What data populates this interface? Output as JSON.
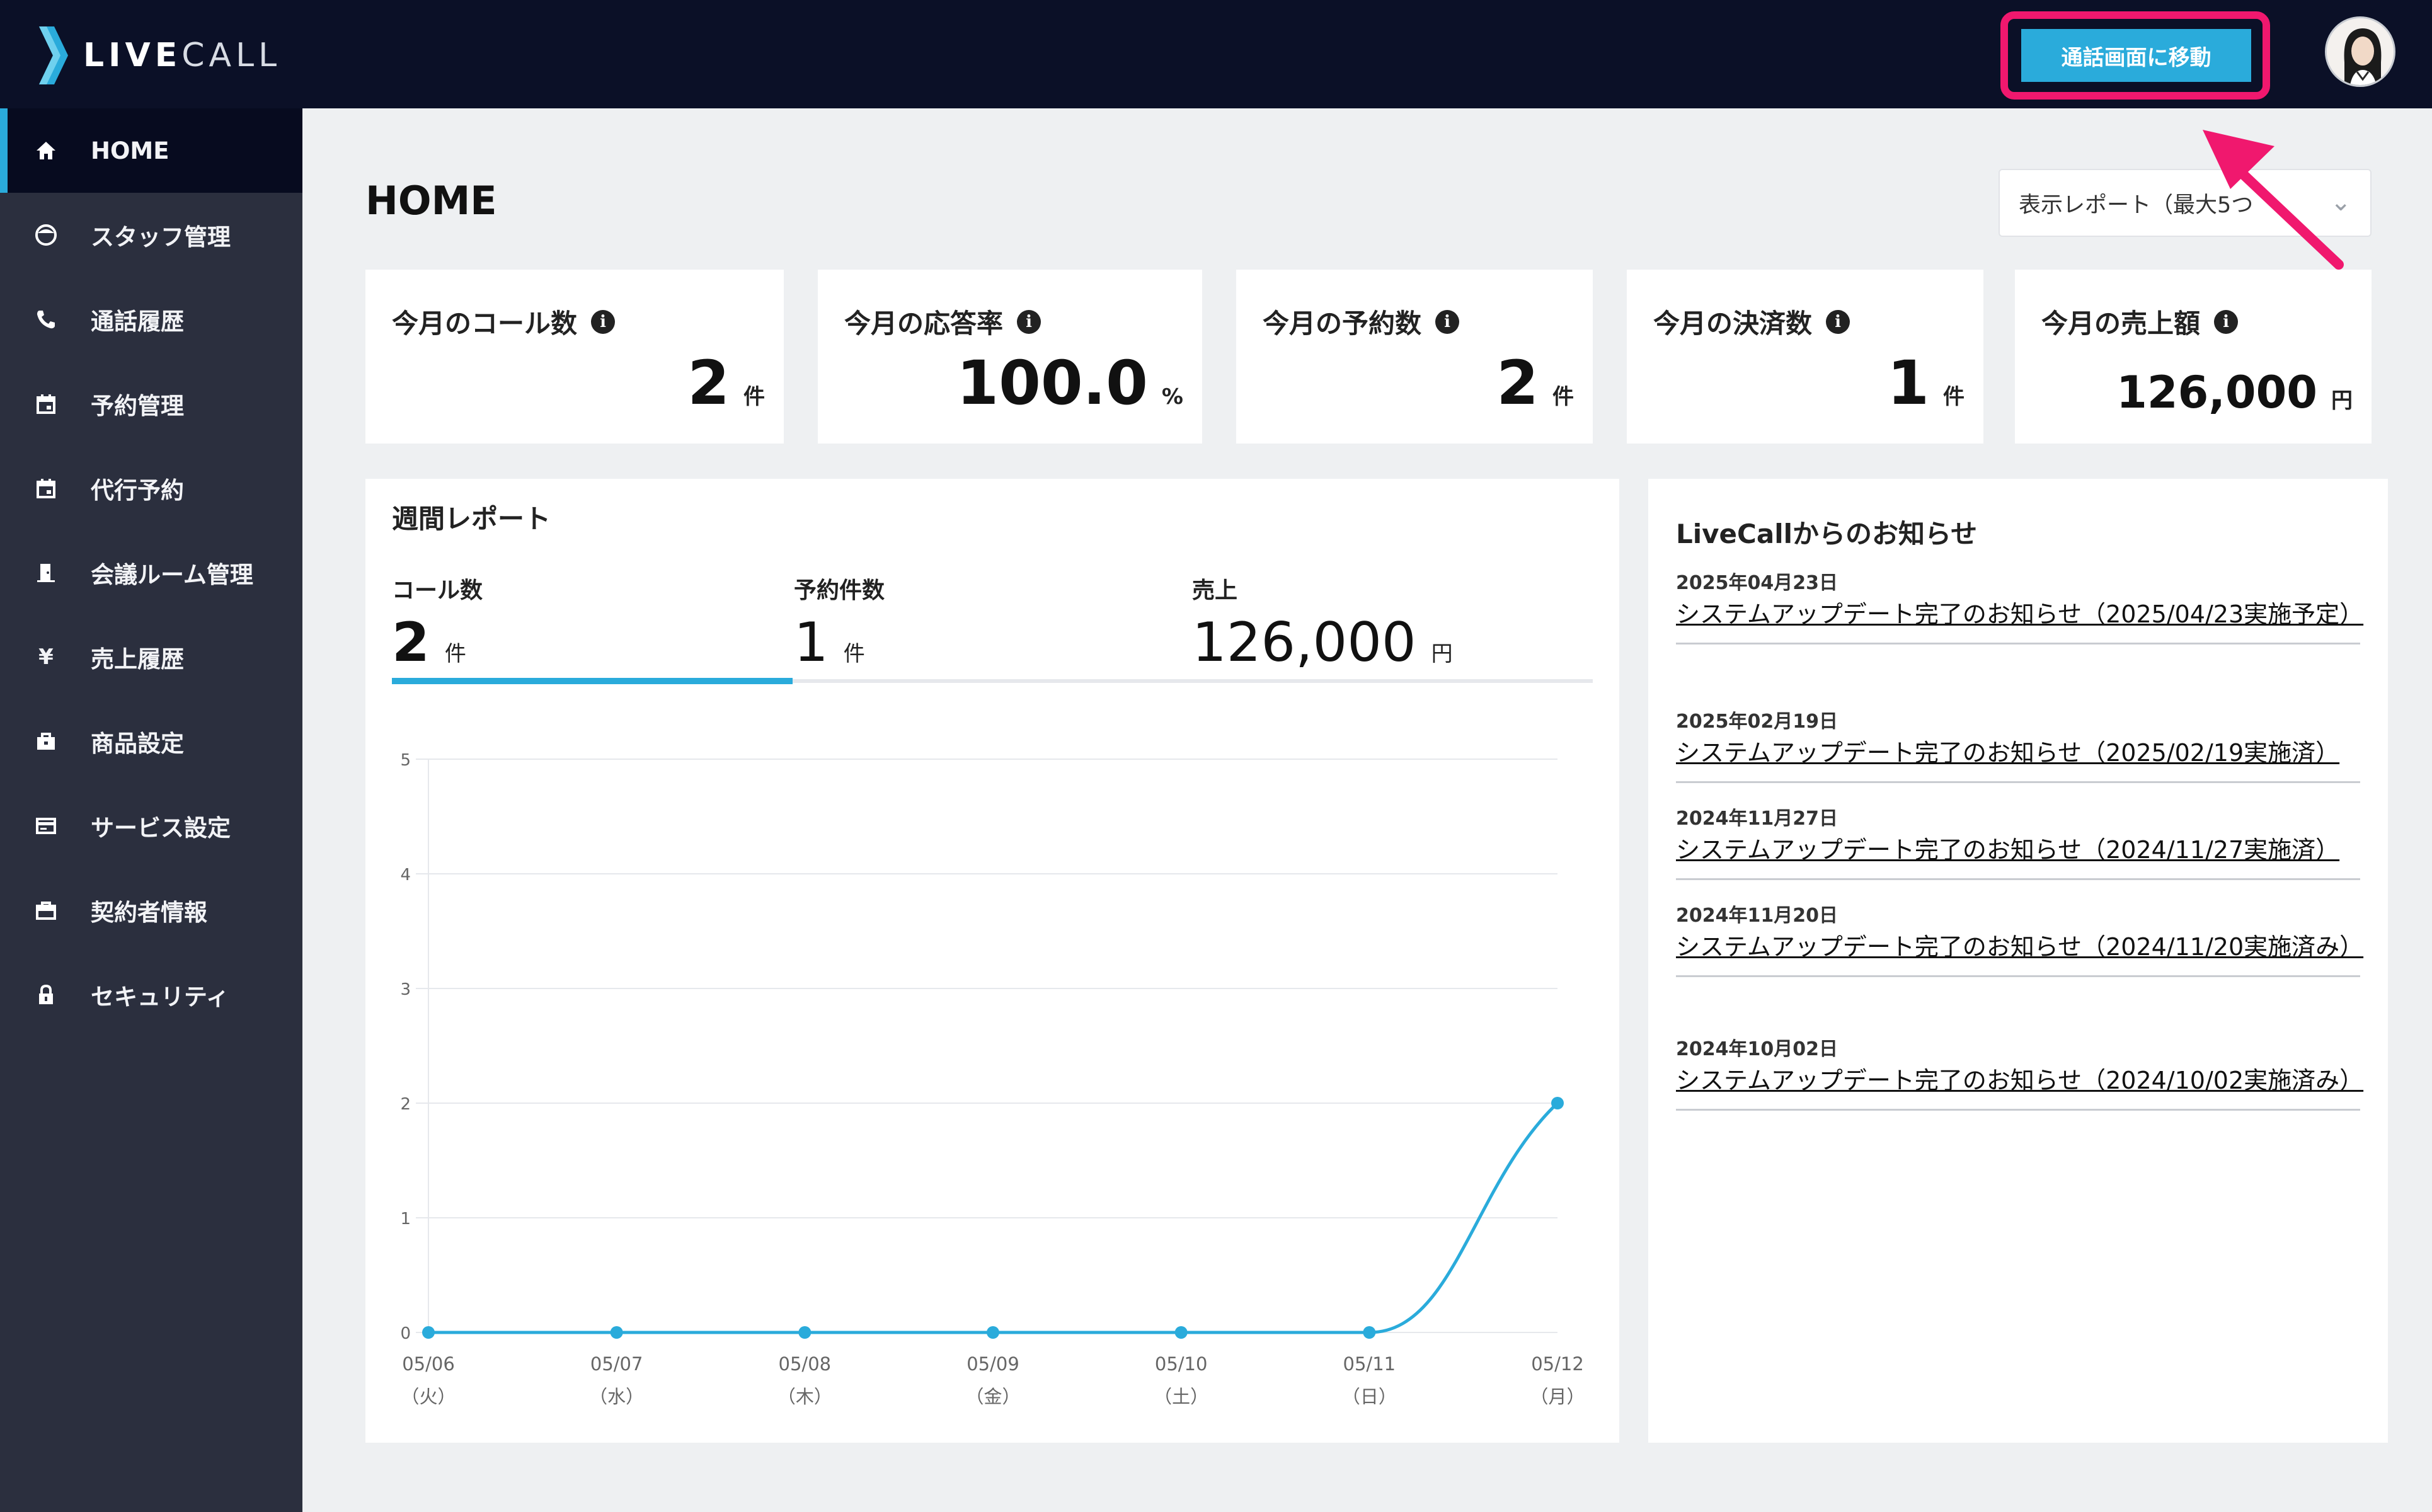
{
  "header": {
    "logo_text_a": "LIVE",
    "logo_text_b": "CALL",
    "call_button_label": "通話画面に移動",
    "brand_color": "#2aabdb",
    "highlight_color": "#f0186e"
  },
  "sidebar": {
    "items": [
      {
        "label": "HOME",
        "icon": "home-icon",
        "glyph": "⌂"
      },
      {
        "label": "スタッフ管理",
        "icon": "staff-icon",
        "glyph": "☺"
      },
      {
        "label": "通話履歴",
        "icon": "phone-icon",
        "glyph": "☏"
      },
      {
        "label": "予約管理",
        "icon": "calendar-icon",
        "glyph": "▦"
      },
      {
        "label": "代行予約",
        "icon": "calendar-plus-icon",
        "glyph": "▦"
      },
      {
        "label": "会議ルーム管理",
        "icon": "door-icon",
        "glyph": "▮"
      },
      {
        "label": "売上履歴",
        "icon": "yen-icon",
        "glyph": "¥"
      },
      {
        "label": "商品設定",
        "icon": "bag-icon",
        "glyph": "▣"
      },
      {
        "label": "サービス設定",
        "icon": "card-icon",
        "glyph": "▤"
      },
      {
        "label": "契約者情報",
        "icon": "briefcase-icon",
        "glyph": "▭"
      },
      {
        "label": "セキュリティ",
        "icon": "lock-icon",
        "glyph": "▲"
      }
    ]
  },
  "main": {
    "title": "HOME",
    "report_select": "表示レポート（最大5つ",
    "stats": [
      {
        "label": "今月のコール数",
        "value": "2",
        "unit": "件"
      },
      {
        "label": "今月の応答率",
        "value": "100.0",
        "unit": "%"
      },
      {
        "label": "今月の予約数",
        "value": "2",
        "unit": "件"
      },
      {
        "label": "今月の決済数",
        "value": "1",
        "unit": "件"
      },
      {
        "label": "今月の売上額",
        "value": "126,000",
        "unit": "円"
      }
    ],
    "weekly": {
      "title": "週間レポート",
      "metrics": [
        {
          "label": "コール数",
          "value": "2",
          "unit": "件"
        },
        {
          "label": "予約件数",
          "value": "1",
          "unit": "件"
        },
        {
          "label": "売上",
          "value": "126,000",
          "unit": "円"
        }
      ]
    }
  },
  "chart_data": {
    "type": "line",
    "title": "",
    "xlabel": "",
    "ylabel": "",
    "categories": [
      "05/06",
      "05/07",
      "05/08",
      "05/09",
      "05/10",
      "05/11",
      "05/12"
    ],
    "weekdays": [
      "（火）",
      "（水）",
      "（木）",
      "（金）",
      "（土）",
      "（日）",
      "（月）"
    ],
    "series": [
      {
        "values": [
          0,
          0,
          0,
          0,
          0,
          0,
          2
        ],
        "color": "#2aabdb"
      }
    ],
    "ylim": [
      0,
      5
    ],
    "yticks": [
      0,
      1,
      2,
      3,
      4,
      5
    ],
    "grid": true
  },
  "news": {
    "title": "LiveCallからのお知らせ",
    "items": [
      {
        "date": "2025年04月23日",
        "text": "システムアップデート完了のお知らせ（2025/04/23実施予定）"
      },
      {
        "date": "2025年02月19日",
        "text": "システムアップデート完了のお知らせ（2025/02/19実施済）"
      },
      {
        "date": "2024年11月27日",
        "text": "システムアップデート完了のお知らせ（2024/11/27実施済）"
      },
      {
        "date": "2024年11月20日",
        "text": "システムアップデート完了のお知らせ（2024/11/20実施済み）"
      },
      {
        "date": "2024年10月02日",
        "text": "システムアップデート完了のお知らせ（2024/10/02実施済み）"
      }
    ]
  }
}
